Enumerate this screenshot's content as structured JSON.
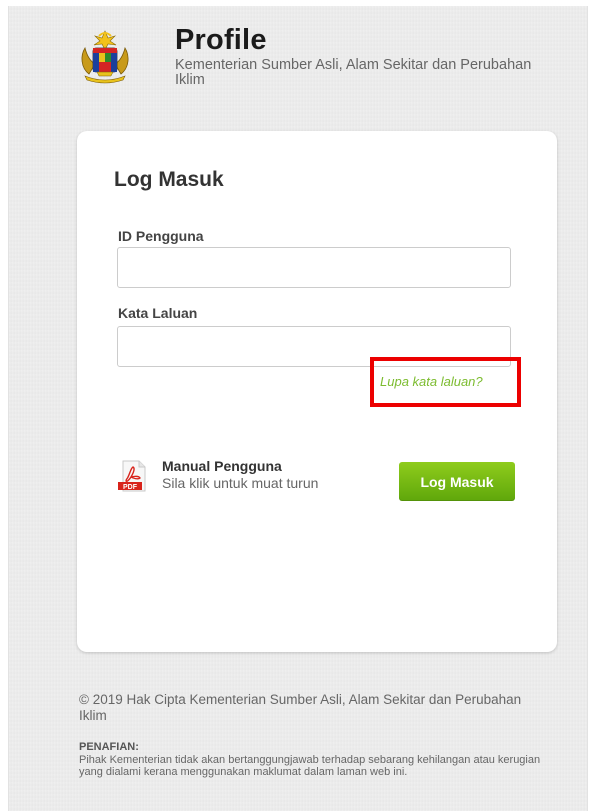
{
  "header": {
    "title": "Profile",
    "subtitle": "Kementerian Sumber Asli, Alam Sekitar dan Perubahan Iklim",
    "logo_icon": "malaysia-coat-of-arms-icon"
  },
  "login": {
    "heading": "Log Masuk",
    "username_label": "ID Pengguna",
    "username_value": "",
    "password_label": "Kata Laluan",
    "password_value": "",
    "forgot_password": "Lupa kata laluan?",
    "submit_label": "Log Masuk"
  },
  "manual": {
    "icon": "pdf-file-icon",
    "title": "Manual Pengguna",
    "subtitle": "Sila klik untuk muat turun"
  },
  "footer": {
    "copyright": "© 2019 Hak Cipta Kementerian Sumber Asli, Alam Sekitar dan Perubahan Iklim",
    "disclaimer_title": "PENAFIAN:",
    "disclaimer_text": "Pihak Kementerian tidak akan bertanggungjawab terhadap sebarang kehilangan atau kerugian yang dialami kerana menggunakan maklumat dalam laman web ini."
  },
  "colors": {
    "accent_green": "#6cb40e",
    "link_green": "#7cbc2f",
    "highlight_red": "#ec0000",
    "background": "#ededed"
  }
}
